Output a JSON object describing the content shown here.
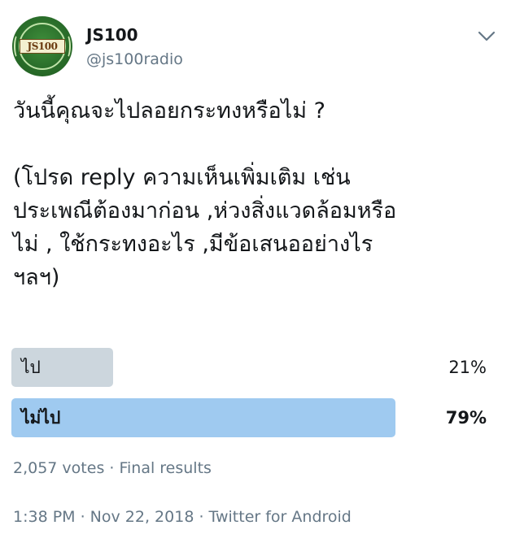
{
  "author": {
    "display_name": "JS100",
    "handle": "@js100radio",
    "avatar_text": "JS100",
    "avatar_colors": {
      "background": "#2a6e2a",
      "plate": "#f3f0d0",
      "text": "#6b3b10"
    }
  },
  "menu_icon": "chevron-down-icon",
  "tweet": {
    "text": "วันนี้คุณจะไปลอยกระทงหรือไม่ ?\n\n(โปรด reply ความเห็นเพิ่มเติม เช่น\nประเพณีต้องมาก่อน ,ห่วงสิ่งแวดล้อมหรือ\nไม่ , ใช้กระทงอะไร ,มีข้อเสนออย่างไร\nฯลฯ)"
  },
  "poll": {
    "options": [
      {
        "label": "ไป",
        "percent_text": "21%",
        "percent": 21,
        "bar_color": "#ccd6dd",
        "winner": false
      },
      {
        "label": "ไม่ไป",
        "percent_text": "79%",
        "percent": 79,
        "bar_color": "#9fcaf0",
        "winner": true
      }
    ],
    "votes": "2,057 votes",
    "separator": "·",
    "status": "Final results",
    "meta_text": "2,057 votes · Final results"
  },
  "footer": {
    "time": "1:38 PM",
    "date": "Nov 22, 2018",
    "source": "Twitter for Android",
    "text": "1:38 PM · Nov 22, 2018 · Twitter for Android"
  },
  "colors": {
    "text_primary": "#14171a",
    "text_secondary": "#657786",
    "accent": "#1da1f2"
  }
}
